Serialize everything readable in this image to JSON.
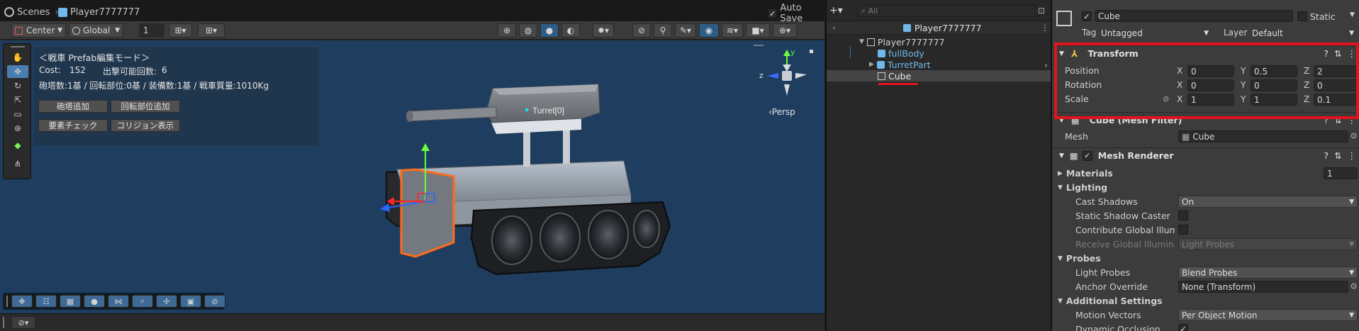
{
  "scene": {
    "tab_label": "Scenes",
    "prefab_name": "Player7777777",
    "auto_save_label": "Auto Save",
    "toolbar": {
      "pivot_mode": "Center",
      "pivot_rotation": "Global",
      "grid_value": "1"
    },
    "gizmo": {
      "y_axis": "y",
      "z_axis": "z",
      "projection": "‹Persp"
    },
    "turret_label": "Turret[0]"
  },
  "prefab_panel": {
    "title": "＜戦車 Prefab編集モード＞",
    "cost_label": "Cost:",
    "cost_value": "152",
    "sorties_label": "出撃可能回数:",
    "sorties_value": "6",
    "stats_line": "砲塔数:1基 / 回転部位:0基 / 装備数:1基 / 戦車質量:1010Kg",
    "buttons": {
      "add_turret": "砲塔追加",
      "add_rotation_part": "回転部位追加",
      "element_check": "要素チェック",
      "show_collision": "コリジョン表示"
    }
  },
  "hierarchy": {
    "search_placeholder": "All",
    "breadcrumb": "Player7777777",
    "items": [
      {
        "label": "Player7777777",
        "depth": 0,
        "expanded": true
      },
      {
        "label": "fullBody",
        "depth": 1
      },
      {
        "label": "TurretPart",
        "depth": 1,
        "collapsed": true
      },
      {
        "label": "Cube",
        "depth": 1,
        "selected": true
      }
    ]
  },
  "inspector": {
    "object_name": "Cube",
    "static_label": "Static",
    "tag_label": "Tag",
    "tag_value": "Untagged",
    "layer_label": "Layer",
    "layer_value": "Default",
    "transform": {
      "title": "Transform",
      "position_label": "Position",
      "rotation_label": "Rotation",
      "scale_label": "Scale",
      "axis_x": "X",
      "axis_y": "Y",
      "axis_z": "Z",
      "position": {
        "x": "0",
        "y": "0.5",
        "z": "2"
      },
      "rotation": {
        "x": "0",
        "y": "0",
        "z": "0"
      },
      "scale": {
        "x": "1",
        "y": "1",
        "z": "0.1"
      }
    },
    "mesh_filter": {
      "title": "Cube (Mesh Filter)",
      "mesh_label": "Mesh",
      "mesh_value": "Cube"
    },
    "mesh_renderer": {
      "title": "Mesh Renderer",
      "materials_label": "Materials",
      "materials_count": "1",
      "lighting_label": "Lighting",
      "cast_shadows_label": "Cast Shadows",
      "cast_shadows_value": "On",
      "static_shadow_caster_label": "Static Shadow Caster",
      "contribute_gi_label": "Contribute Global Illumina",
      "receive_gi_label": "Receive Global Illuminati",
      "receive_gi_value": "Light Probes",
      "probes_label": "Probes",
      "light_probes_label": "Light Probes",
      "light_probes_value": "Blend Probes",
      "anchor_override_label": "Anchor Override",
      "anchor_override_value": "None (Transform)",
      "additional_settings_label": "Additional Settings",
      "motion_vectors_label": "Motion Vectors",
      "motion_vectors_value": "Per Object Motion",
      "dynamic_occlusion_label": "Dynamic Occlusion"
    }
  },
  "colors": {
    "highlight_red": "#e0141c",
    "selection_blue": "#2c5d87",
    "viewport_bg": "#1f3d5e",
    "prefab_blue": "#6fb8ea"
  }
}
